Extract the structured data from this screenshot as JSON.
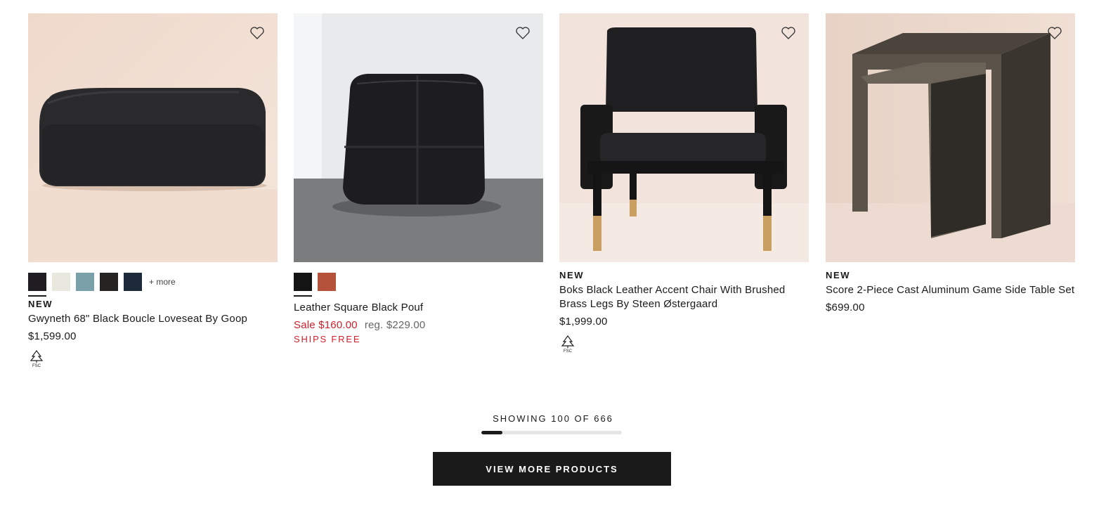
{
  "products": [
    {
      "badge": "NEW",
      "name": "Gwyneth 68\" Black Boucle Loveseat By Goop",
      "price": "$1,599.00",
      "swatches": [
        "#1f1d22",
        "#e9e8de",
        "#7aa0aa",
        "#252422",
        "#1c2a3a"
      ],
      "more_label": "+ more",
      "favorite_icon": "heart-outline-icon",
      "certification_icon": "fsc-icon"
    },
    {
      "badge": "",
      "name": "Leather Square Black Pouf",
      "sale_price": "Sale $160.00",
      "reg_price": "reg. $229.00",
      "shipping": "SHIPS FREE",
      "swatches": [
        "#141414",
        "#b4523a"
      ],
      "favorite_icon": "heart-outline-icon"
    },
    {
      "badge": "NEW",
      "name": "Boks Black Leather Accent Chair With Brushed Brass Legs By Steen Østergaard",
      "price": "$1,999.00",
      "favorite_icon": "heart-outline-icon",
      "certification_icon": "fsc-icon"
    },
    {
      "badge": "NEW",
      "name": "Score 2-Piece Cast Aluminum Game Side Table Set",
      "price": "$699.00",
      "favorite_icon": "heart-outline-icon"
    }
  ],
  "pagination": {
    "showing_text": "SHOWING 100 OF 666",
    "shown": 100,
    "total": 666,
    "button_label": "VIEW MORE PRODUCTS"
  },
  "colors": {
    "sale": "#d31f2a",
    "button_bg": "#1a1a1a",
    "text": "#1a1a1a"
  }
}
